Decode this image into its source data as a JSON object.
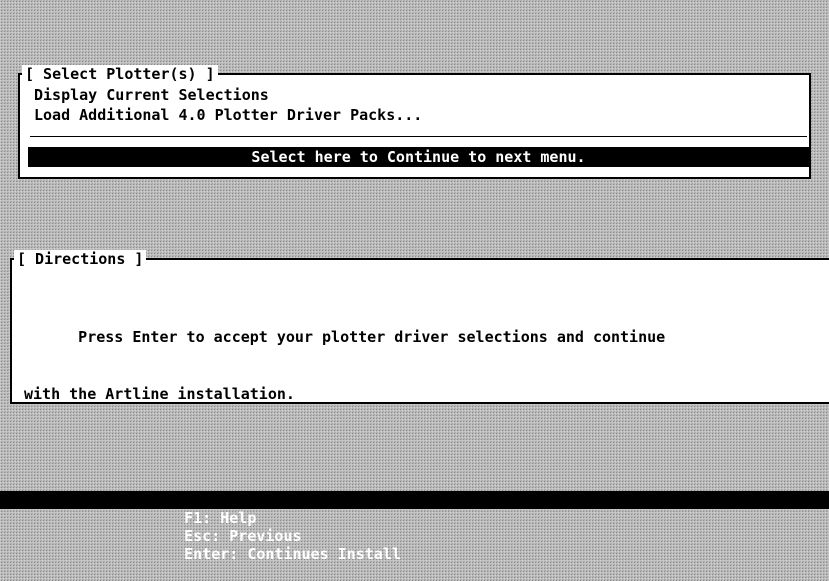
{
  "plotter_box": {
    "title": "[ Select Plotter(s) ]",
    "items": [
      "Display Current Selections",
      "Load Additional 4.0 Plotter Driver Packs..."
    ],
    "continue_label": "Select here to Continue to next menu."
  },
  "directions": {
    "title": "[ Directions ]",
    "line1": "      Press Enter to accept your plotter driver selections and continue",
    "line2": "with the Artline installation."
  },
  "statusbar": {
    "help": "F1: Help",
    "previous": "Esc: Previous",
    "continue": "Enter: Continues Install"
  }
}
